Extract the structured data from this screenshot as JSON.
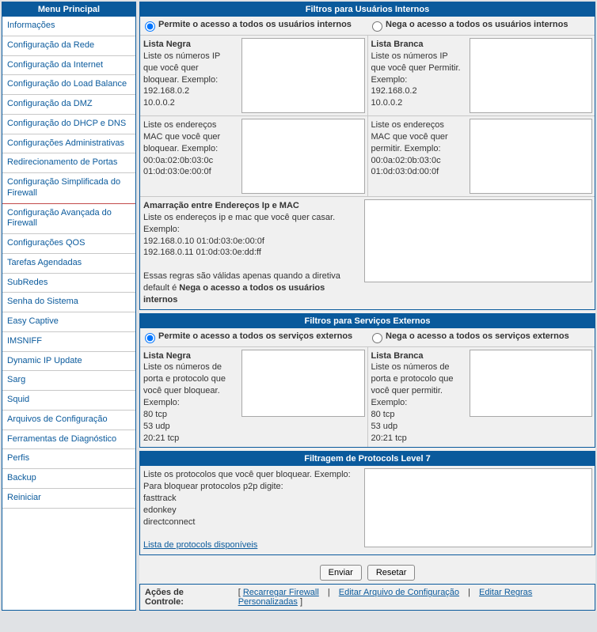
{
  "sidebar": {
    "title": "Menu Principal",
    "items": [
      {
        "label": "Informações"
      },
      {
        "label": "Configuração da Rede"
      },
      {
        "label": "Configuração da Internet"
      },
      {
        "label": "Configuração do Load Balance"
      },
      {
        "label": "Configuração da DMZ"
      },
      {
        "label": "Configuração do DHCP e DNS"
      },
      {
        "label": "Configurações Administrativas"
      },
      {
        "label": "Redirecionamento de Portas"
      },
      {
        "label": "Configuração Simplificada do Firewall"
      },
      {
        "label": "Configuração Avançada do Firewall"
      },
      {
        "label": "Configurações QOS"
      },
      {
        "label": "Tarefas Agendadas"
      },
      {
        "label": "SubRedes"
      },
      {
        "label": "Senha do Sistema"
      },
      {
        "label": "Easy Captive"
      },
      {
        "label": "IMSNIFF"
      },
      {
        "label": "Dynamic IP Update"
      },
      {
        "label": "Sarg"
      },
      {
        "label": "Squid"
      },
      {
        "label": "Arquivos de Configuração"
      },
      {
        "label": "Ferramentas de Diagnóstico"
      },
      {
        "label": "Perfis"
      },
      {
        "label": "Backup"
      },
      {
        "label": "Reiniciar"
      }
    ]
  },
  "internos": {
    "header": "Filtros para Usuários Internos",
    "allow": "Permite o acesso a todos os usuários internos",
    "deny": "Nega o acesso a todos os usuários internos",
    "black_title": "Lista Negra",
    "black_ip": "Liste os números IP que você quer bloquear. Exemplo:\n192.168.0.2\n10.0.0.2",
    "white_title": "Lista Branca",
    "white_ip": "Liste os números IP que você quer Permitir. Exemplo:\n192.168.0.2\n10.0.0.2",
    "black_mac": "Liste os endereços MAC que você quer bloquear. Exemplo:\n00:0a:02:0b:03:0c\n01:0d:03:0e:00:0f",
    "white_mac": "Liste os endereços MAC que você quer permitir. Exemplo:\n00:0a:02:0b:03:0c\n01:0d:03:0d:00:0f",
    "ipmac_title": "Amarração entre Endereços Ip e MAC",
    "ipmac_desc1": "Liste os endereços ip e mac que você quer casar. Exemplo:",
    "ipmac_desc2": "192.168.0.10 01:0d:03:0e:00:0f",
    "ipmac_desc3": "192.168.0.11 01:0d:03:0e:dd:ff",
    "ipmac_desc4a": "Essas regras são válidas apenas quando a diretiva default é ",
    "ipmac_desc4b": "Nega o acesso a todos os usuários internos"
  },
  "externos": {
    "header": "Filtros para Serviços Externos",
    "allow": "Permite o acesso a todos os serviços externos",
    "deny": "Nega o acesso a todos os serviços externos",
    "black_title": "Lista Negra",
    "black_desc": "Liste os números de porta e protocolo que você quer bloquear. Exemplo:\n80 tcp\n53 udp\n20:21 tcp",
    "white_title": "Lista Branca",
    "white_desc": "Liste os números de porta e protocolo que você quer permitir. Exemplo:\n80 tcp\n53 udp\n20:21 tcp"
  },
  "l7": {
    "header": "Filtragem de Protocols Level 7",
    "desc": "Liste os protocolos que você quer bloquear. Exemplo: Para bloquear protocolos p2p digite:\nfasttrack\nedonkey\ndirectconnect",
    "link": "Lista de protocols disponíveis"
  },
  "buttons": {
    "submit": "Enviar",
    "reset": "Resetar"
  },
  "control": {
    "label": "Ações de Controle:",
    "reload": "Recarregar Firewall",
    "edit_conf": "Editar Arquivo de Configuração",
    "edit_rules": "Editar Regras Personalizadas"
  },
  "colors": {
    "primary": "#0a5a9c"
  }
}
